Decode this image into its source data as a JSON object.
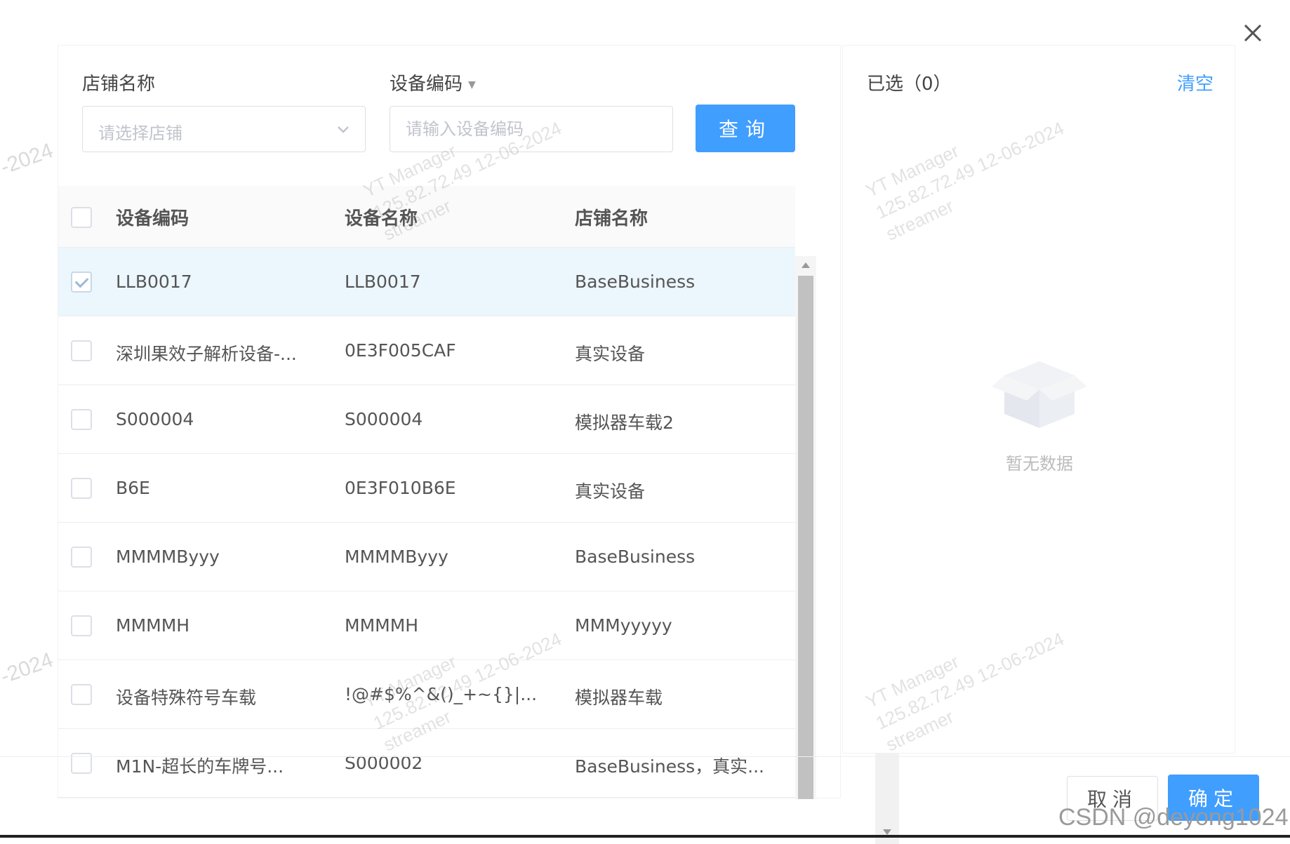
{
  "dialog": {
    "close_icon": "close-icon"
  },
  "filters": {
    "store_label": "店铺名称",
    "store_placeholder": "请选择店铺",
    "code_label": "设备编码",
    "code_placeholder": "请输入设备编码",
    "query_label": "查询"
  },
  "table": {
    "headers": [
      "设备编码",
      "设备名称",
      "店铺名称"
    ],
    "rows": [
      {
        "code": "LLB0017",
        "name": "LLB0017",
        "store": "BaseBusiness",
        "checked": true
      },
      {
        "code": "深圳果效子解析设备-...",
        "name": "0E3F005CAF",
        "store": "真实设备",
        "checked": false
      },
      {
        "code": "S000004",
        "name": "S000004",
        "store": "模拟器车载2",
        "checked": false
      },
      {
        "code": "B6E",
        "name": "0E3F010B6E",
        "store": "真实设备",
        "checked": false
      },
      {
        "code": "MMMMByyy",
        "name": "MMMMByyy",
        "store": "BaseBusiness",
        "checked": false
      },
      {
        "code": "MMMMH",
        "name": "MMMMH",
        "store": "MMMyyyyy",
        "checked": false
      },
      {
        "code": "设备特殊符号车载",
        "name": "!@#$%^&()_+~{}|...",
        "store": "模拟器车载",
        "checked": false
      },
      {
        "code": "M1N-超长的车牌号...",
        "name": "S000002",
        "store": "BaseBusiness，真实...",
        "checked": false
      }
    ]
  },
  "selected_panel": {
    "title": "已选（0）",
    "clear_label": "清空",
    "empty_text": "暂无数据",
    "empty_icon": "empty-box-icon"
  },
  "footer": {
    "cancel_label": "取消",
    "confirm_label": "确定"
  },
  "watermark": {
    "line1": "YT Manager",
    "line2": "125.82.72.49 12-06-2024",
    "line3": "streamer",
    "edge": "-2024"
  },
  "credit": "CSDN @deyong1024"
}
